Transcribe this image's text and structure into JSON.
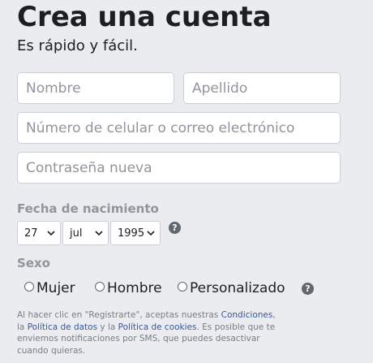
{
  "header": {
    "title": "Crea una cuenta",
    "subtitle": "Es rápido y fácil."
  },
  "form": {
    "first_name_placeholder": "Nombre",
    "last_name_placeholder": "Apellido",
    "contact_placeholder": "Número de celular o correo electrónico",
    "password_placeholder": "Contraseña nueva"
  },
  "birthday": {
    "label": "Fecha de nacimiento",
    "day": "27",
    "month": "jul",
    "year": "1995",
    "help_icon": "question-circle-icon"
  },
  "gender": {
    "label": "Sexo",
    "options": [
      "Mujer",
      "Hombre",
      "Personalizado"
    ],
    "help_icon": "question-circle-icon"
  },
  "legal": {
    "t1": "Al hacer clic en \"Registrarte\", aceptas nuestras ",
    "condiciones": "Condiciones",
    "t2": ", la ",
    "politica_datos": "Política de datos",
    "t3": " y la ",
    "politica_cookies": "Política de cookies",
    "t4": ". Es posible que te enviemos notificaciones por SMS, que puedes desactivar cuando quieras."
  },
  "colors": {
    "background": "#ebecf0",
    "link": "#385898",
    "placeholder": "#90949c"
  }
}
